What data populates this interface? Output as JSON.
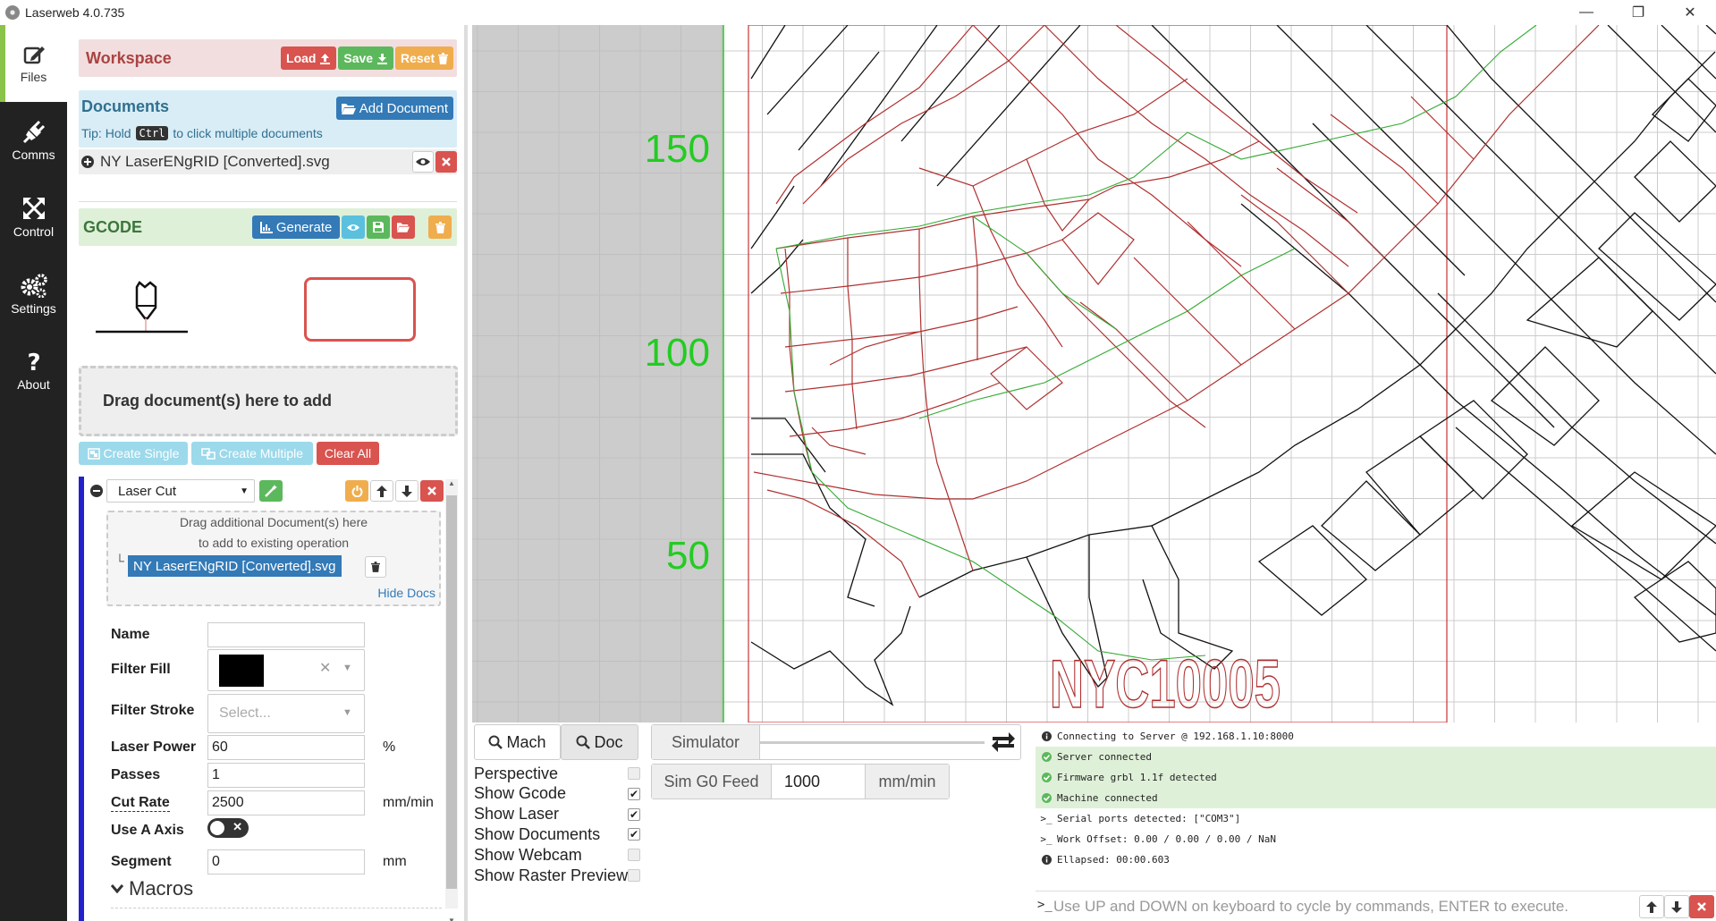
{
  "window": {
    "title": "Laserweb 4.0.735",
    "min": "—",
    "max": "❐",
    "close": "✕"
  },
  "sidebar": [
    {
      "label": "Files"
    },
    {
      "label": "Comms"
    },
    {
      "label": "Control"
    },
    {
      "label": "Settings"
    },
    {
      "label": "About"
    }
  ],
  "workspace": {
    "title": "Workspace",
    "load": "Load",
    "save": "Save",
    "reset": "Reset"
  },
  "documents": {
    "title": "Documents",
    "add": "Add Document",
    "tip_prefix": "Tip: Hold",
    "tip_key": "Ctrl",
    "tip_suffix": "to click multiple documents",
    "file": "NY LaserENgRID [Converted].svg"
  },
  "gcode": {
    "title": "GCODE",
    "generate": "Generate"
  },
  "drag": {
    "text": "Drag document(s) here to add"
  },
  "ops": {
    "create_single": "Create Single",
    "create_multiple": "Create Multiple",
    "clear_all": "Clear All"
  },
  "operation": {
    "type": "Laser Cut",
    "drag_hint_1": "Drag additional Document(s) here",
    "drag_hint_2": "to add to existing operation",
    "doc": "NY LaserENgRID [Converted].svg",
    "hide_docs": "Hide Docs",
    "fields": {
      "name_label": "Name",
      "name_value": "",
      "fill_label": "Filter Fill",
      "stroke_label": "Filter Stroke",
      "stroke_placeholder": "Select...",
      "power_label": "Laser Power",
      "power_value": "60",
      "power_unit": "%",
      "passes_label": "Passes",
      "passes_value": "1",
      "rate_label": "Cut Rate",
      "rate_value": "2500",
      "rate_unit": "mm/min",
      "axis_label": "Use A Axis",
      "segment_label": "Segment",
      "segment_value": "0",
      "segment_unit": "mm",
      "macros": "Macros"
    }
  },
  "viewport": {
    "labels": [
      "150",
      "100",
      "50"
    ],
    "text": "NYC10005"
  },
  "view": {
    "mach": "Mach",
    "doc": "Doc",
    "simulator": "Simulator",
    "sim_feed": "Sim G0 Feed",
    "feed_value": "1000",
    "feed_unit": "mm/min"
  },
  "checks": [
    {
      "label": "Perspective",
      "checked": false
    },
    {
      "label": "Show Gcode",
      "checked": true
    },
    {
      "label": "Show Laser",
      "checked": true
    },
    {
      "label": "Show Documents",
      "checked": true
    },
    {
      "label": "Show Webcam",
      "checked": false
    },
    {
      "label": "Show Raster Preview",
      "checked": false
    }
  ],
  "console": {
    "lines": [
      {
        "icon": "info",
        "text": "Connecting to Server @ 192.168.1.10:8000"
      },
      {
        "icon": "check",
        "text": "Server connected"
      },
      {
        "icon": "check",
        "text": "Firmware grbl 1.1f detected"
      },
      {
        "icon": "check",
        "text": "Machine connected"
      },
      {
        "icon": "prompt",
        "text": "Serial ports detected: [\"COM3\"]"
      },
      {
        "icon": "prompt",
        "text": "Work Offset: 0.00 / 0.00 / 0.00 / NaN"
      },
      {
        "icon": "info",
        "text": "Ellapsed: 00:00.603"
      }
    ],
    "input_placeholder": "Use UP and DOWN on keyboard to cycle by commands, ENTER to execute."
  },
  "colors": {
    "accent_green": "#5cb85c",
    "danger": "#d9534f",
    "primary": "#337ab7",
    "warning": "#f0ad4e",
    "sidebar": "#222222"
  }
}
